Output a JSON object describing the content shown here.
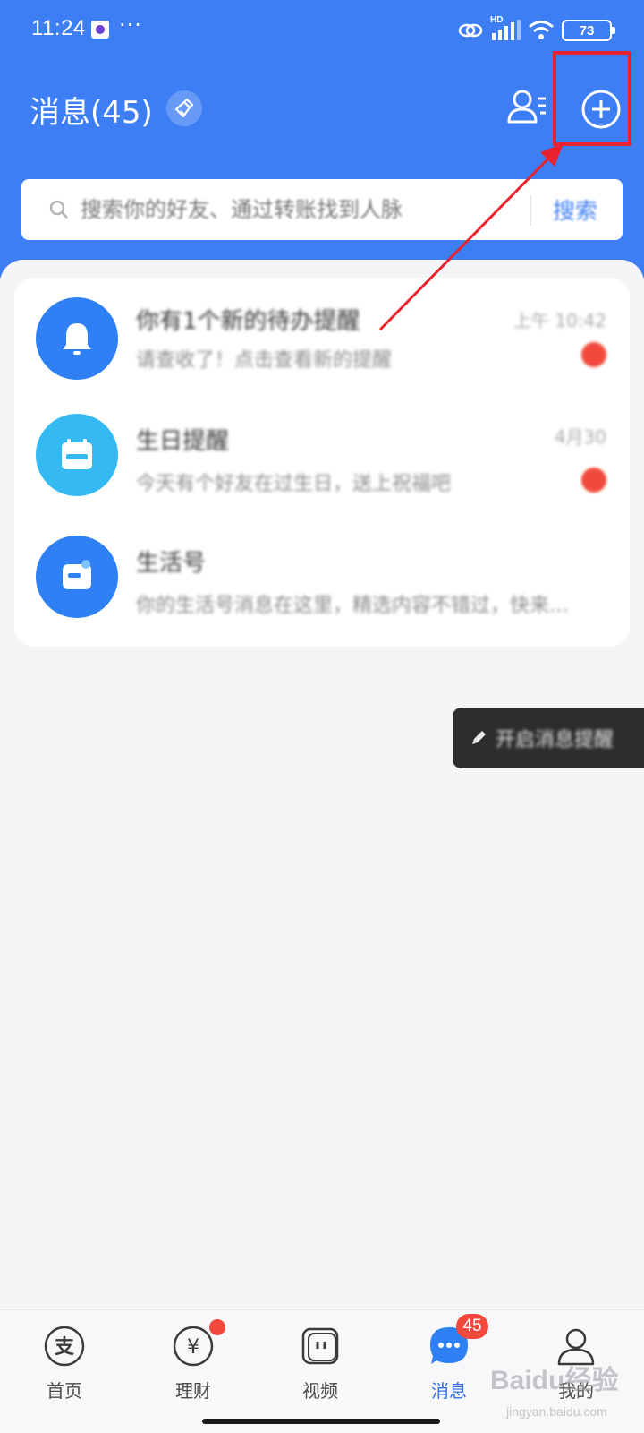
{
  "status_bar": {
    "time": "11:24",
    "dots": "···",
    "network_type": "HD",
    "battery_level": "73"
  },
  "header": {
    "title": "消息(45)",
    "icons": [
      "broom-icon",
      "contacts-icon",
      "add-circle-icon"
    ]
  },
  "search": {
    "placeholder": "搜索你的好友、通过转账找到人脉",
    "button_label": "搜索"
  },
  "messages": [
    {
      "title": "你有1个新的待办提醒",
      "subtitle": "请查收了！点击查看新的提醒",
      "time": "上午 10:42",
      "unread": true,
      "avatar_icon": "bell-icon"
    },
    {
      "title": "生日提醒",
      "subtitle": "今天有个好友在过生日，送上祝福吧",
      "time": "4月30",
      "unread": true,
      "avatar_icon": "calendar-icon"
    },
    {
      "title": "生活号",
      "subtitle": "你的生活号消息在这里，精选内容不错过，快来看看吧",
      "time": "",
      "unread": false,
      "avatar_icon": "life-account-icon"
    }
  ],
  "float_tip": {
    "text": "开启消息提醒"
  },
  "tab_bar": {
    "tabs": [
      {
        "label": "首页",
        "icon": "alipay-home-icon",
        "active": false
      },
      {
        "label": "理财",
        "icon": "wealth-icon",
        "active": false,
        "dot": true
      },
      {
        "label": "视频",
        "icon": "video-icon",
        "active": false
      },
      {
        "label": "消息",
        "icon": "message-icon",
        "active": true,
        "badge": "45"
      },
      {
        "label": "我的",
        "icon": "profile-icon",
        "active": false
      }
    ]
  },
  "watermark": {
    "logo": "Baidu经验",
    "url": "jingyan.baidu.com"
  },
  "annotation": {
    "highlight_color": "#e9222f"
  },
  "colors": {
    "header_blue": "#3d7ef5",
    "badge_red": "#f2493c",
    "active_tab": "#2f6fe8"
  }
}
